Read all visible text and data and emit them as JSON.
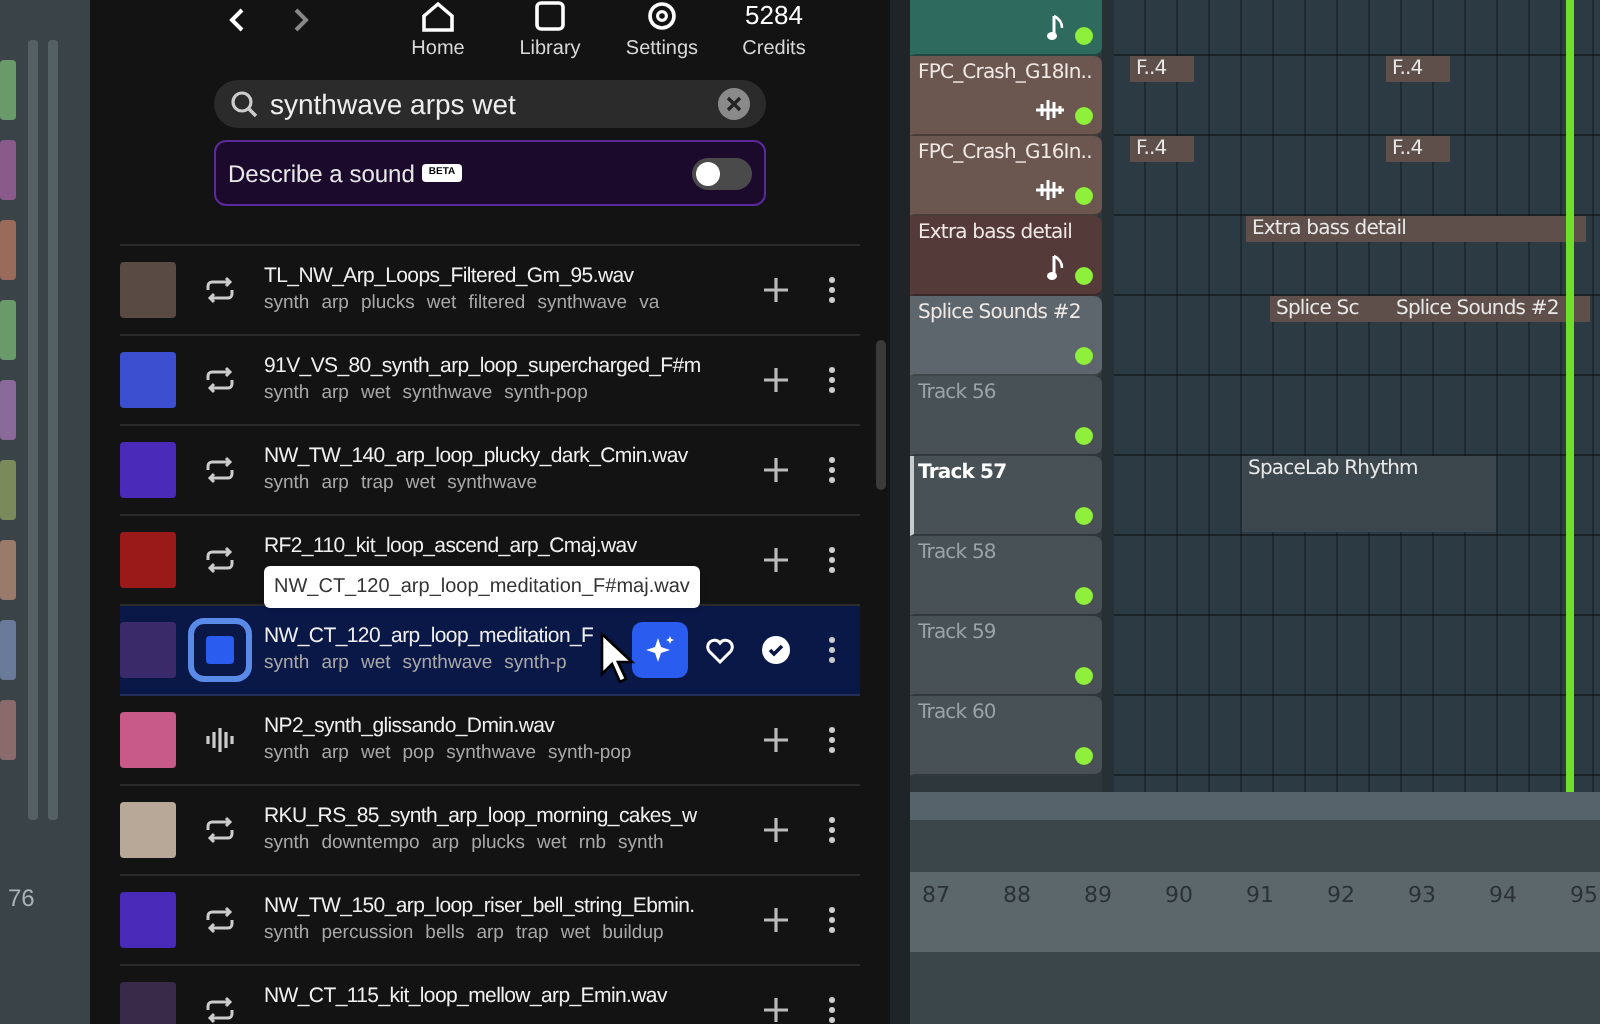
{
  "nav": {
    "items": [
      {
        "kind": "home",
        "label": "Home"
      },
      {
        "kind": "library",
        "label": "Library"
      },
      {
        "kind": "settings",
        "label": "Settings"
      },
      {
        "kind": "credits",
        "value": "5284",
        "label": "Credits"
      }
    ]
  },
  "search": {
    "value": "synthwave arps wet"
  },
  "describe": {
    "label": "Describe a sound",
    "badge": "BETA",
    "on": false
  },
  "results": [
    {
      "kind": "loop",
      "title": "TL_NW_Arp_Loops_Filtered_Gm_95.wav",
      "tags": [
        "synth",
        "arp",
        "plucks",
        "wet",
        "filtered",
        "synthwave",
        "va"
      ],
      "selected": false,
      "color": "#5a4a44"
    },
    {
      "kind": "loop",
      "title": "91V_VS_80_synth_arp_loop_supercharged_F#m",
      "tags": [
        "synth",
        "arp",
        "wet",
        "synthwave",
        "synth-pop"
      ],
      "selected": false,
      "color": "#3b4fd0"
    },
    {
      "kind": "loop",
      "title": "NW_TW_140_arp_loop_plucky_dark_Cmin.wav",
      "tags": [
        "synth",
        "arp",
        "trap",
        "wet",
        "synthwave"
      ],
      "selected": false,
      "color": "#4a2ab8"
    },
    {
      "kind": "loop",
      "title": "RF2_110_kit_loop_ascend_arp_Cmaj.wav",
      "selected": false,
      "color": "#9a1a1a"
    },
    {
      "kind": "loop",
      "title": "NW_CT_120_arp_loop_meditation_F",
      "tags": [
        "synth",
        "arp",
        "wet",
        "synthwave",
        "synth-p"
      ],
      "selected": true,
      "color": "#3a2a6a"
    },
    {
      "kind": "oneshot",
      "title": "NP2_synth_glissando_Dmin.wav",
      "tags": [
        "synth",
        "arp",
        "wet",
        "pop",
        "synthwave",
        "synth-pop"
      ],
      "selected": false,
      "color": "#c85a8a"
    },
    {
      "kind": "loop",
      "title": "RKU_RS_85_synth_arp_loop_morning_cakes_w",
      "tags": [
        "synth",
        "downtempo",
        "arp",
        "plucks",
        "wet",
        "rnb",
        "synth"
      ],
      "selected": false,
      "color": "#b8a898"
    },
    {
      "kind": "loop",
      "title": "NW_TW_150_arp_loop_riser_bell_string_Ebmin.",
      "tags": [
        "synth",
        "percussion",
        "bells",
        "arp",
        "trap",
        "wet",
        "buildup"
      ],
      "selected": false,
      "color": "#4a2ab8"
    },
    {
      "kind": "loop",
      "title": "NW_CT_115_kit_loop_mellow_arp_Emin.wav",
      "selected": false,
      "color": "#3a2a4a"
    }
  ],
  "tooltip": "NW_CT_120_arp_loop_meditation_F#maj.wav",
  "tracks": [
    {
      "kind": "note",
      "color": "#2e6b5e",
      "selected": false
    },
    {
      "kind": "audio",
      "name": "FPC_Crash_G18In..",
      "color": "#6b5650",
      "clips": [
        "F..4",
        "F..4"
      ],
      "selected": false
    },
    {
      "kind": "audio",
      "name": "FPC_Crash_G16In..",
      "color": "#6b5650",
      "clips": [
        "F..4",
        "F..4"
      ],
      "selected": false
    },
    {
      "kind": "note",
      "name": "Extra bass detail",
      "color": "#553a3a",
      "clips": [
        "Extra bass detail"
      ],
      "selected": false
    },
    {
      "kind": "plugin",
      "name": "Splice Sounds #2",
      "color": "#5c666c",
      "clips": [
        "Splice Sc",
        "Splice Sounds #2"
      ],
      "selected": false
    },
    {
      "kind": "empty",
      "name": "Track 56",
      "color": "#485256",
      "selected": false
    },
    {
      "kind": "empty",
      "name": "Track 57",
      "color": "#485256",
      "clips": [
        "SpaceLab Rhythm"
      ],
      "selected": true
    },
    {
      "kind": "empty",
      "name": "Track 58",
      "color": "#485256",
      "selected": false
    },
    {
      "kind": "empty",
      "name": "Track 59",
      "color": "#485256",
      "selected": false
    },
    {
      "kind": "empty",
      "name": "Track 60",
      "color": "#485256",
      "selected": false
    }
  ],
  "ruler": [
    "87",
    "88",
    "89",
    "90",
    "91",
    "92",
    "93",
    "94",
    "95"
  ],
  "left_ruler": "76"
}
